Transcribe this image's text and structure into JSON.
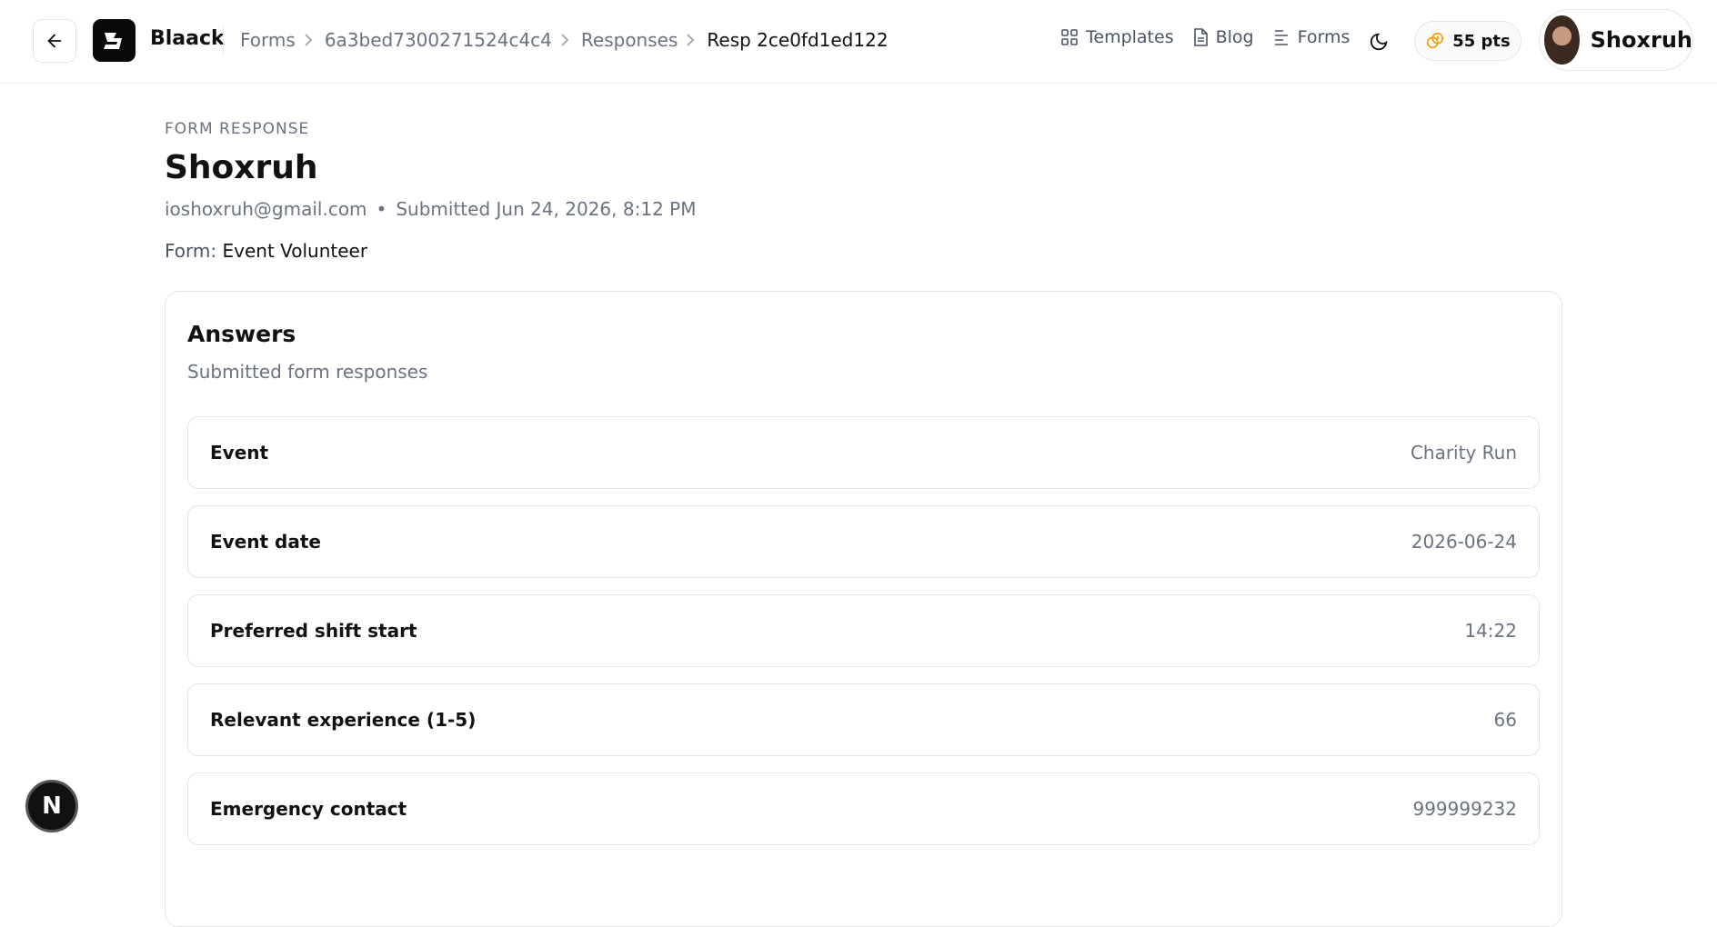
{
  "header": {
    "brand": "Blaack",
    "breadcrumb": [
      {
        "label": "Forms"
      },
      {
        "label": "6a3bed7300271524c4c4"
      },
      {
        "label": "Responses"
      },
      {
        "label": "Resp 2ce0fd1ed122"
      }
    ],
    "nav": [
      {
        "label": "Templates",
        "icon": "grid-icon"
      },
      {
        "label": "Blog",
        "icon": "document-icon"
      },
      {
        "label": "Forms",
        "icon": "list-icon"
      }
    ],
    "points": "55 pts",
    "user_name": "Shoxruh"
  },
  "response": {
    "eyebrow": "FORM RESPONSE",
    "name": "Shoxruh",
    "email": "ioshoxruh@gmail.com",
    "separator": "•",
    "submitted": "Submitted Jun 24, 2026, 8:12 PM",
    "form_prefix": "Form:",
    "form_name": "Event Volunteer"
  },
  "answers": {
    "title": "Answers",
    "subtitle": "Submitted form responses",
    "items": [
      {
        "label": "Event",
        "value": "Charity Run"
      },
      {
        "label": "Event date",
        "value": "2026-06-24"
      },
      {
        "label": "Preferred shift start",
        "value": "14:22"
      },
      {
        "label": "Relevant experience (1-5)",
        "value": "66"
      },
      {
        "label": "Emergency contact",
        "value": "999999232"
      }
    ]
  },
  "badge": "N",
  "colors": {
    "accent": "#111111",
    "muted": "#6b7280",
    "border": "#e5e5e5",
    "points_icon": "#f59e0b"
  }
}
